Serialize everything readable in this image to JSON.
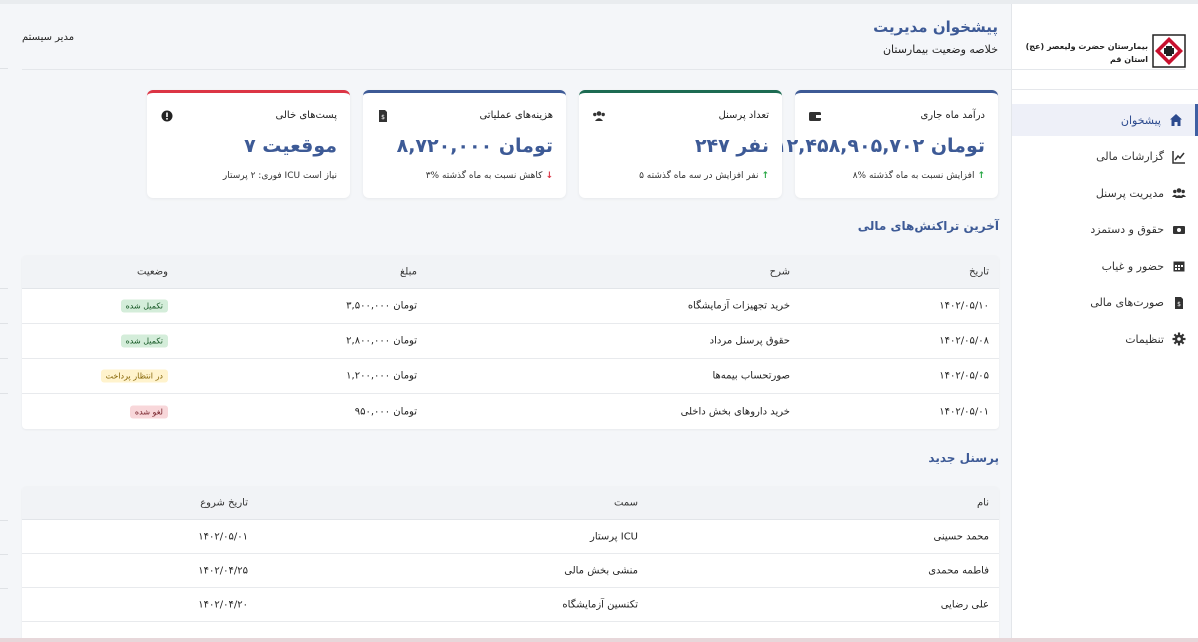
{
  "sidebar": {
    "logo_line1": "بیمارستان حضرت ولیعصر (عج)",
    "logo_line2": "استان قم",
    "items": [
      {
        "label": "پیشخوان",
        "icon": "home-icon",
        "active": true
      },
      {
        "label": "گزارشات مالی",
        "icon": "chart-line-icon"
      },
      {
        "label": "مدیریت پرسنل",
        "icon": "users-icon"
      },
      {
        "label": "حقوق و دستمزد",
        "icon": "money-icon"
      },
      {
        "label": "حضور و غیاب",
        "icon": "calendar-icon"
      },
      {
        "label": "صورت‌های مالی",
        "icon": "invoice-icon"
      },
      {
        "label": "تنظیمات",
        "icon": "gear-icon"
      }
    ]
  },
  "header": {
    "title": "پیشخوان مدیریت",
    "subtitle": "خلاصه وضعیت بیمارستان",
    "user": "مدیر سیستم"
  },
  "cards": [
    {
      "title": "درآمد ماه جاری",
      "value": "۱۲,۴۵۸,۹۰۵,۷۰۲ تومان",
      "note": "۸% افزایش نسبت به ماه گذشته",
      "trend": "up",
      "icon": "wallet-icon",
      "color": "#3d5a96"
    },
    {
      "title": "تعداد پرسنل",
      "value": "۲۴۷ نفر",
      "note": "۵ نفر افزایش در سه ماه گذشته",
      "trend": "up",
      "icon": "users-icon",
      "color": "#1d6b52"
    },
    {
      "title": "هزینه‌های عملیاتی",
      "value": "۸,۷۲۰,۰۰۰ تومان",
      "note": "۳% کاهش نسبت به ماه گذشته",
      "trend": "down",
      "icon": "invoice-icon",
      "color": "#3d5a96"
    },
    {
      "title": "پست‌های خالی",
      "value": "۷ موقعیت",
      "note": "فوری: ۲ پرستار ICU نیاز است",
      "trend": "none",
      "icon": "alert-icon",
      "color": "#dc3545"
    }
  ],
  "transactions": {
    "title": "آخرین تراکنش‌های مالی",
    "headers": {
      "date": "تاریخ",
      "desc": "شرح",
      "amount": "مبلغ",
      "status": "وضعیت"
    },
    "rows": [
      {
        "date": "۱۴۰۲/۰۵/۱۰",
        "desc": "خرید تجهیزات آزمایشگاه",
        "amount": "۳,۵۰۰,۰۰۰ تومان",
        "status": "تکمیل شده",
        "status_type": "green"
      },
      {
        "date": "۱۴۰۲/۰۵/۰۸",
        "desc": "حقوق پرسنل مرداد",
        "amount": "۲,۸۰۰,۰۰۰ تومان",
        "status": "تکمیل شده",
        "status_type": "green"
      },
      {
        "date": "۱۴۰۲/۰۵/۰۵",
        "desc": "صورتحساب بیمه‌ها",
        "amount": "۱,۲۰۰,۰۰۰ تومان",
        "status": "در انتظار پرداخت",
        "status_type": "yellow"
      },
      {
        "date": "۱۴۰۲/۰۵/۰۱",
        "desc": "خرید داروهای بخش داخلی",
        "amount": "۹۵۰,۰۰۰ تومان",
        "status": "لغو شده",
        "status_type": "red"
      }
    ]
  },
  "staff": {
    "title": "پرسنل جدید",
    "headers": {
      "name": "نام",
      "role": "سمت",
      "start": "تاریخ شروع"
    },
    "rows": [
      {
        "name": "محمد حسینی",
        "role": "پرستار ICU",
        "start": "۱۴۰۲/۰۵/۰۱"
      },
      {
        "name": "فاطمه محمدی",
        "role": "منشی بخش مالی",
        "start": "۱۴۰۲/۰۴/۲۵"
      },
      {
        "name": "علی رضایی",
        "role": "تکنسین آزمایشگاه",
        "start": "۱۴۰۲/۰۴/۲۰"
      }
    ]
  }
}
